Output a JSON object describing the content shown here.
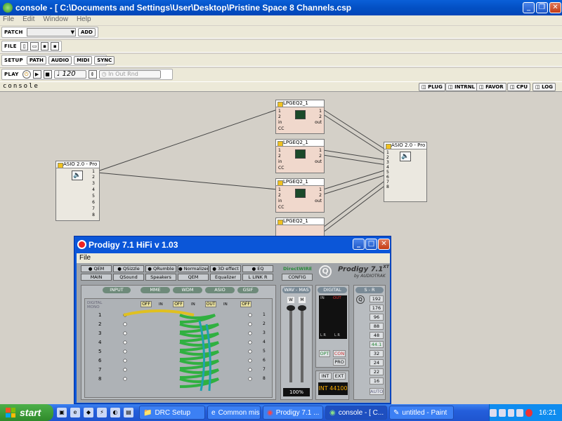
{
  "console_window": {
    "title": "console - [ C:\\Documents and Settings\\User\\Desktop\\Pristine Space 8 Channels.csp",
    "menus": [
      "File",
      "Edit",
      "Window",
      "Help"
    ]
  },
  "toolbars": {
    "patch": {
      "label": "PATCH",
      "add": "ADD"
    },
    "file": {
      "label": "FILE"
    },
    "setup": {
      "label": "SETUP",
      "buttons": [
        "PATH",
        "AUDIO",
        "MIDI",
        "SYNC"
      ]
    },
    "play": {
      "label": "PLAY",
      "tempo": "120",
      "inout": "In Out Rnd"
    }
  },
  "console_bar": {
    "name": "console",
    "buttons": [
      "PLUG",
      "INTRNL",
      "FAVOR",
      "CPU",
      "LOG"
    ]
  },
  "modules": {
    "asio_in": {
      "title": "ASIO 2.0 - Pro",
      "pins": [
        "1",
        "2",
        "3",
        "4",
        "5",
        "6",
        "7",
        "8"
      ]
    },
    "asio_out": {
      "title": "ASIO 2.0 - Pro",
      "pins": [
        "1",
        "2",
        "3",
        "4",
        "5",
        "6",
        "7",
        "8"
      ]
    },
    "lpgeq": [
      {
        "title": "LPGEQ2_1",
        "in_pins": [
          "1",
          "2",
          "in",
          "CC"
        ],
        "out_pins": [
          "1",
          "2",
          "out"
        ]
      },
      {
        "title": "LPGEQ2_1",
        "in_pins": [
          "1",
          "2",
          "in",
          "CC"
        ],
        "out_pins": [
          "1",
          "2",
          "out"
        ]
      },
      {
        "title": "LPGEQ2_1",
        "in_pins": [
          "1",
          "2",
          "in",
          "CC"
        ],
        "out_pins": [
          "1",
          "2",
          "out"
        ]
      },
      {
        "title": "LPGEQ2_1"
      }
    ]
  },
  "prodigy": {
    "title": "Prodigy 7.1 HiFi v 1.03",
    "menu": "File",
    "effects_top": [
      "QEM",
      "QSizzle",
      "QRumble",
      "Normalizer",
      "3D effect",
      "EQ"
    ],
    "effects_bottom": [
      "MAIN",
      "QSound",
      "Speakers",
      "QEM",
      "Equalizer",
      "L LINK R"
    ],
    "directwire": "DirectWIRE",
    "config": "CONFIG",
    "brand": "Prodigy 7.1",
    "brand_sup": "XT",
    "brand_sub": "by AUDIOTRAK",
    "router_headers": [
      "INPUT",
      "MME",
      "WDM",
      "ASIO",
      "GSIF"
    ],
    "digital_mono": "DIGITAL\nMONO",
    "off_labels": [
      "OFF",
      "OFF",
      "OUT",
      "OFF"
    ],
    "in_label": "IN",
    "rows": [
      "1",
      "2",
      "3",
      "4",
      "5",
      "6",
      "7",
      "8"
    ],
    "wav_mas": "WAV - MAS",
    "fader_labels": [
      "W",
      "M"
    ],
    "volume_pct": "100%",
    "digital": {
      "label": "DIGITAL",
      "in": "IN",
      "out": "OUT",
      "lr": [
        "L R",
        "L R"
      ],
      "opt": "OPT",
      "con": "CON",
      "pro": "PRO"
    },
    "clock": {
      "int": "INT",
      "ext": "EXT",
      "readout": "INT 44100"
    },
    "sr": {
      "label": "S - R",
      "rates": [
        "192",
        "176",
        "96",
        "88",
        "48",
        "44.1",
        "32",
        "24",
        "22",
        "16"
      ],
      "auto": "AUTO",
      "active": "44.1"
    }
  },
  "taskbar": {
    "start": "start",
    "tasks": [
      "DRC Setup",
      "Common mis...",
      "Prodigy 7.1 ...",
      "console - [ C...",
      "untitled - Paint"
    ],
    "active_task": "console - [ C...",
    "clock": "16:21"
  },
  "colors": {
    "titlebar": "#0a5fd8",
    "taskbar": "#245edb",
    "start": "#3a9d35",
    "module": "#f0d8cc",
    "cable_yellow": "#e0c020",
    "cable_green": "#30b040",
    "cable_teal": "#20a0b0"
  }
}
